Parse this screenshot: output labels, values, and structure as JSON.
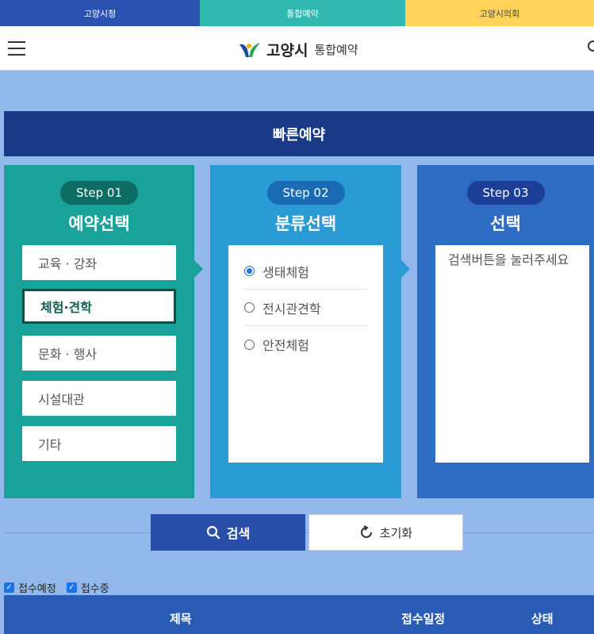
{
  "topbar": {
    "link1": "고양시청",
    "link2": "통합예약",
    "link3": "고양시의회"
  },
  "header": {
    "logo_text": "고양시",
    "logo_sub": "통합예약"
  },
  "quick": {
    "title": "빠른예약"
  },
  "step1": {
    "badge": "Step 01",
    "title": "예약선택",
    "items": [
      "교육 · 강좌",
      "체험·견학",
      "문화 · 행사",
      "시설대관",
      "기타"
    ]
  },
  "step2": {
    "badge": "Step 02",
    "title": "분류선택",
    "options": [
      "생태체험",
      "전시관견학",
      "안전체험"
    ]
  },
  "step3": {
    "badge": "Step 03",
    "title": "선택",
    "hint": "검색버튼을 눌러주세요"
  },
  "buttons": {
    "search": "검색",
    "reset": "초기화"
  },
  "filters": {
    "f1": "접수예정",
    "f2": "접수중"
  },
  "table": {
    "col_title": "제목",
    "col_date": "접수일정",
    "col_status": "상태"
  },
  "colors": {
    "accent": "#2a4fa8",
    "step1": "#19a29a",
    "step2": "#2b9bd6",
    "step3": "#2e6bc2",
    "navy": "#1a3a87"
  }
}
